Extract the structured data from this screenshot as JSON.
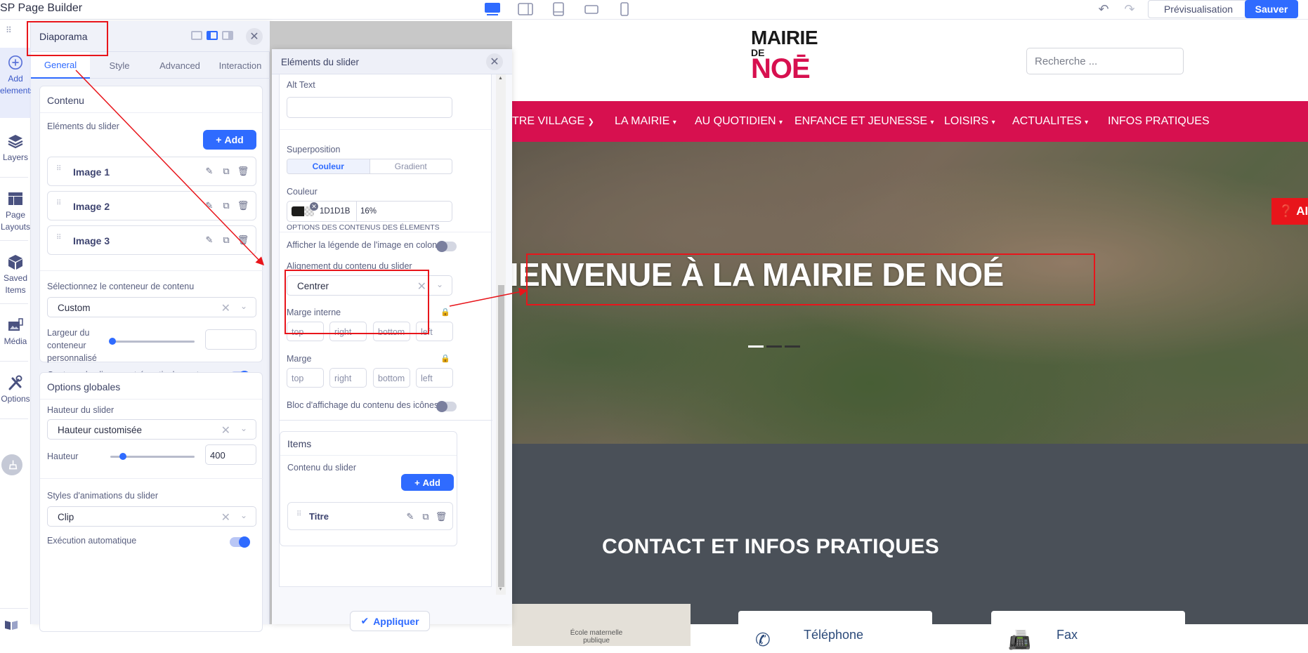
{
  "app": {
    "title": "SP Page Builder"
  },
  "toolbar": {
    "devices": [
      {
        "name": "desktop",
        "active": true
      },
      {
        "name": "tablet-landscape",
        "active": false
      },
      {
        "name": "tablet-portrait",
        "active": false
      },
      {
        "name": "mobile-landscape",
        "active": false
      },
      {
        "name": "mobile-portrait",
        "active": false
      }
    ],
    "preview_label": "Prévisualisation",
    "save_label": "Sauver"
  },
  "rail": {
    "items": [
      {
        "icon": "add-circle-icon",
        "label1": "Add",
        "label2": "elements",
        "active": true
      },
      {
        "icon": "layers-icon",
        "label1": "Layers",
        "label2": ""
      },
      {
        "icon": "page-layouts-icon",
        "label1": "Page",
        "label2": "Layouts"
      },
      {
        "icon": "saved-items-icon",
        "label1": "Saved",
        "label2": "Items"
      },
      {
        "icon": "media-icon",
        "label1": "Média",
        "label2": ""
      },
      {
        "icon": "options-wrench-icon",
        "label1": "Options",
        "label2": ""
      }
    ]
  },
  "panel": {
    "title": "Diaporama",
    "tabs": [
      "General",
      "Style",
      "Advanced",
      "Interaction"
    ],
    "active_tab": "General",
    "contenu": {
      "heading": "Contenu",
      "items_label": "Eléments du slider",
      "add_label": "Add",
      "items": [
        "Image 1",
        "Image 2",
        "Image 3"
      ],
      "container_label": "Sélectionnez le conteneur de contenu",
      "container_value": "Custom",
      "width_label": [
        "Largeur du",
        "conteneur",
        "personnalisé"
      ],
      "width_value": "",
      "width_slider_fraction": 0.0,
      "vcenter_label": "Contenu du sliver, centré verticalement.",
      "vcenter_on": true
    },
    "global": {
      "heading": "Options globales",
      "height_mode_label": "Hauteur du slider",
      "height_mode_value": "Hauteur customisée",
      "height_label": "Hauteur",
      "height_value": "400",
      "height_slider_fraction": 0.12,
      "anim_label": "Styles d'animations du slider",
      "anim_value": "Clip",
      "autoplay_label": "Exécution automatique",
      "autoplay_on": true
    }
  },
  "modal": {
    "title": "Eléments du slider",
    "alt_text_label": "Alt Text",
    "alt_text_value": "",
    "overlay_label": "Superposition",
    "overlay_options": [
      "Couleur",
      "Gradient"
    ],
    "overlay_active": "Couleur",
    "color_label": "Couleur",
    "color_hex": "1D1D1B",
    "color_swatch": "#1D1D1B",
    "color_opacity": "16%",
    "content_options_heading": "OPTIONS DES CONTENUS DES ÉLEMENTS",
    "caption_column_label": "Afficher la légende de l'image en colonne",
    "caption_column_on": false,
    "alignment_label": "Alignement du contenu du slider",
    "alignment_value": "Centrer",
    "padding_label": "Marge interne",
    "margin_label": "Marge",
    "box_placeholders": [
      "top",
      "right",
      "bottom",
      "left"
    ],
    "icon_block_label": "Bloc d'affichage du contenu des icônes",
    "icon_block_on": false,
    "items_heading": "Items",
    "slider_content_label": "Contenu du slider",
    "add_label": "Add",
    "content_items": [
      "Titre"
    ],
    "apply_label": "Appliquer"
  },
  "site": {
    "logo": {
      "line1": "MAIRIE",
      "line2": "DE",
      "line3": "NOĒ"
    },
    "search_placeholder": "Recherche ...",
    "nav": [
      "NOTRE VILLAGE",
      "LA MAIRIE",
      "AU QUOTIDIEN",
      "ENFANCE ET JEUNESSE",
      "LOISIRS",
      "ACTUALITES",
      "INFOS PRATIQUES"
    ],
    "nav_dropdowns": [
      true,
      true,
      true,
      true,
      true,
      true,
      false
    ],
    "hero_title": "BIENVENUE À LA MAIRIE DE NOÉ",
    "hero_slides": 3,
    "hero_active_slide": 1,
    "aide_label": "AIDE",
    "contact_title": "CONTACT ET INFOS PRATIQUES",
    "map_label": "École maternelle publique",
    "cards": [
      {
        "icon": "phone-icon",
        "title": "Téléphone"
      },
      {
        "icon": "fax-icon",
        "title": "Fax"
      }
    ],
    "brand_color": "#D7104F",
    "accent_color": "#2F6BFF"
  }
}
